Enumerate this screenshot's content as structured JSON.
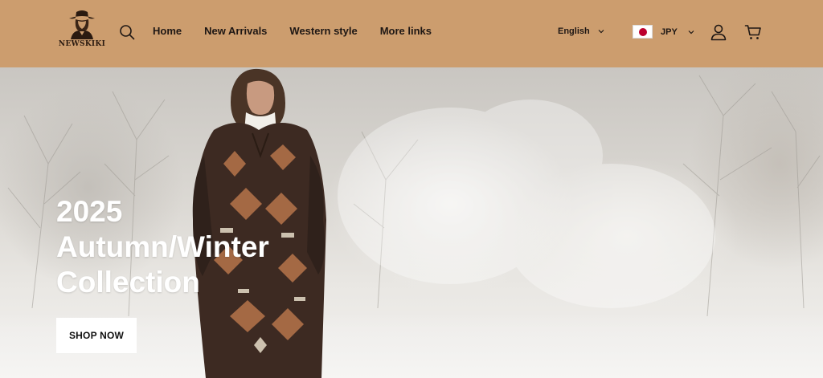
{
  "brand": {
    "logo_text": "NEWSKIKI"
  },
  "header": {
    "bg_color": "#cc9d6e",
    "nav": [
      {
        "label": "Home"
      },
      {
        "label": "New Arrivals"
      },
      {
        "label": "Western style"
      },
      {
        "label": "More links"
      }
    ],
    "language": {
      "selected": "English"
    },
    "currency": {
      "selected": "JPY",
      "flag": "japan-flag"
    },
    "icons": [
      "search-icon",
      "account-icon",
      "cart-icon"
    ]
  },
  "hero": {
    "title_lines": [
      "2025",
      "Autumn/Winter",
      "Collection"
    ],
    "cta_label": "SHOP NOW"
  }
}
